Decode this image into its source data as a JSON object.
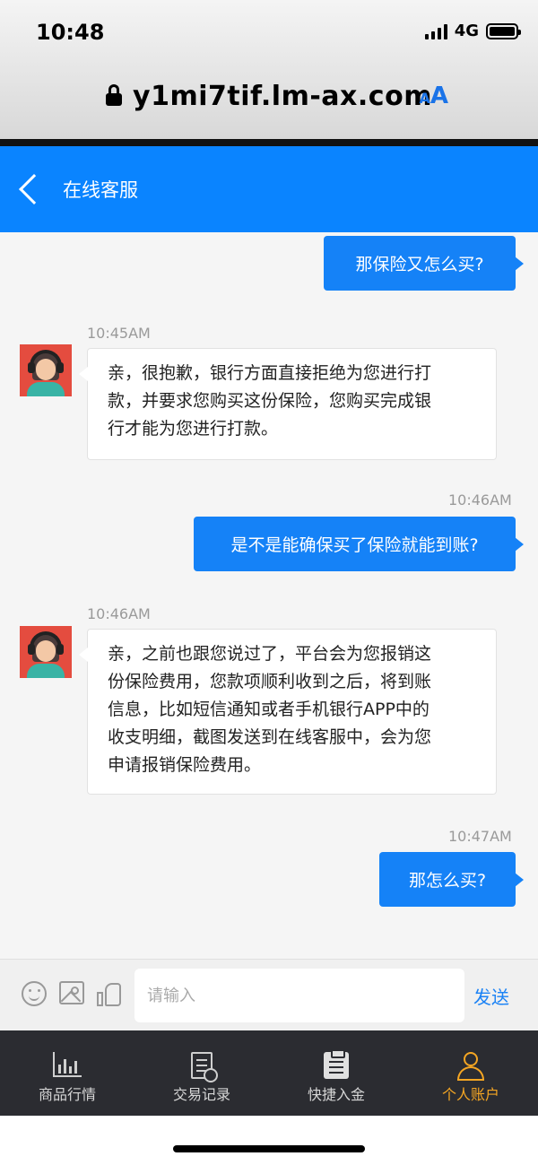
{
  "status_bar": {
    "time": "10:48",
    "network": "4G"
  },
  "browser": {
    "url": "y1mi7tif.lm-ax.com",
    "text_size_small": "A",
    "text_size_big": "A"
  },
  "header": {
    "title": "在线客服"
  },
  "messages": [
    {
      "direction": "out",
      "text": "那保险又怎么买?"
    },
    {
      "direction": "in",
      "time": "10:45AM",
      "lines": [
        "亲，很抱歉，银行方面直接拒绝为您进行打",
        "款，并要求您购买这份保险，您购买完成银",
        "行才能为您进行打款。"
      ]
    },
    {
      "direction": "out",
      "time": "10:46AM",
      "text": "是不是能确保买了保险就能到账?"
    },
    {
      "direction": "in",
      "time": "10:46AM",
      "lines": [
        "亲，之前也跟您说过了，平台会为您报销这",
        "份保险费用，您款项顺利收到之后，将到账",
        "信息，比如短信通知或者手机银行APP中的",
        "收支明细，截图发送到在线客服中，会为您",
        "申请报销保险费用。"
      ]
    },
    {
      "direction": "out",
      "time": "10:47AM",
      "text": "那怎么买?"
    }
  ],
  "input": {
    "placeholder": "请输入",
    "value": "",
    "send_label": "发送"
  },
  "tabs": [
    {
      "label": "商品行情",
      "icon": "chart-icon",
      "active": false
    },
    {
      "label": "交易记录",
      "icon": "document-clock-icon",
      "active": false
    },
    {
      "label": "快捷入金",
      "icon": "clipboard-icon",
      "active": false
    },
    {
      "label": "个人账户",
      "icon": "user-icon",
      "active": true
    }
  ],
  "colors": {
    "header_blue": "#0a84ff",
    "bubble_blue": "#1582f7",
    "active_tab": "#f5a623",
    "tabbar_bg": "#2b2c31"
  }
}
